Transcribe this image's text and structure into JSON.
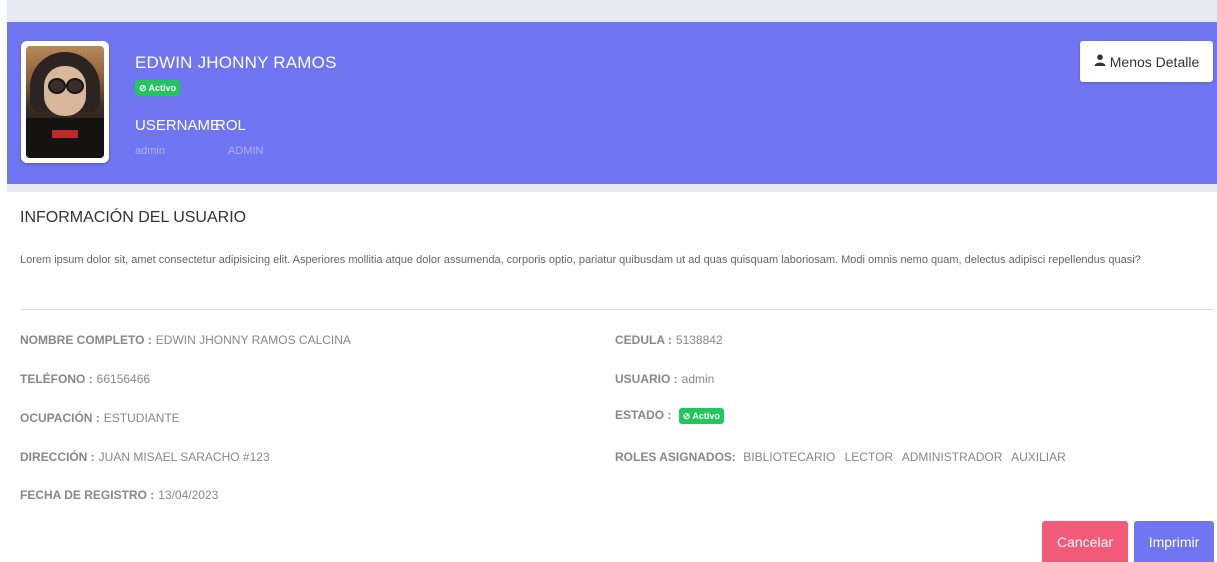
{
  "header": {
    "name": "EDWIN JHONNY RAMOS",
    "status_badge": "Activo",
    "username_label": "USERNAME",
    "username_value": "admin",
    "rol_label": "ROL",
    "rol_value": "ADMIN",
    "toggle_detail_label": "Menos Detalle",
    "toggle_detail_icon": "user-icon",
    "status_icon": "check-circle-icon"
  },
  "info": {
    "title": "INFORMACIÓN DEL USUARIO",
    "description": "Lorem ipsum dolor sit, amet consectetur adipisicing elit. Asperiores mollitia atque dolor assumenda, corporis optio, pariatur quibusdam ut ad quas quisquam laboriosam. Modi omnis nemo quam, delectus adipisci repellendus quasi?",
    "fields_left": [
      {
        "label": "NOMBRE COMPLETO :",
        "value": "EDWIN JHONNY RAMOS CALCINA"
      },
      {
        "label": "TELÉFONO :",
        "value": "66156466"
      },
      {
        "label": "OCUPACIÓN :",
        "value": "ESTUDIANTE"
      },
      {
        "label": "DIRECCIÓN :",
        "value": "JUAN MISAEL SARACHO #123"
      },
      {
        "label": "FECHA DE REGISTRO :",
        "value": "13/04/2023"
      }
    ],
    "fields_right": {
      "cedula_label": "CEDULA :",
      "cedula_value": "5138842",
      "usuario_label": "USUARIO :",
      "usuario_value": "admin",
      "estado_label": "ESTADO :",
      "estado_value": "Activo",
      "roles_label": "ROLES ASIGNADOS:",
      "roles": [
        "BIBLIOTECARIO",
        "LECTOR",
        "ADMINISTRADOR",
        "AUXILIAR"
      ]
    }
  },
  "actions": {
    "cancel_label": "Cancelar",
    "print_label": "Imprimir"
  },
  "colors": {
    "banner": "#7076f2",
    "badge_active": "#22c55e",
    "cancel": "#f25a7a",
    "print": "#7076f2"
  }
}
